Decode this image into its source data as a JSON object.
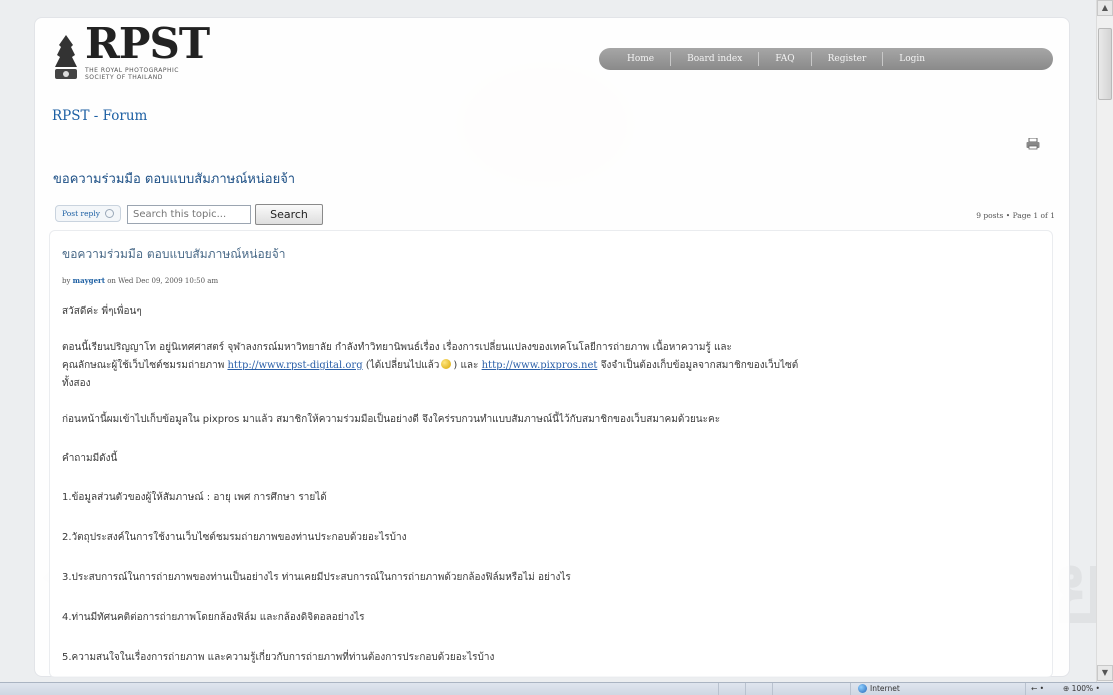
{
  "watermark": {
    "line1": "ศูนย์วิทยทรัพยากร",
    "line2": "จุฬาลงกรณ์มหาวิทยาลัย"
  },
  "logo": {
    "letters": "RPST",
    "subtitle": "THE ROYAL PHOTOGRAPHIC SOCIETY OF THAILAND"
  },
  "site_title": "RPST - Forum",
  "nav": [
    "Home",
    "Board index",
    "FAQ",
    "Register",
    "Login"
  ],
  "topic": {
    "title": "ขอความร่วมมือ ตอบแบบสัมภาษณ์หน่อยจ้า"
  },
  "actions": {
    "post_reply": "Post reply",
    "search_placeholder": "Search this topic...",
    "search_button": "Search",
    "pagination": "9 posts • Page 1 of 1"
  },
  "post": {
    "title": "ขอความร่วมมือ ตอบแบบสัมภาษณ์หน่อยจ้า",
    "meta_by": "by",
    "author": "maygert",
    "meta_date": "on Wed Dec 09, 2009 10:50 am",
    "greeting": "สวัสดีค่ะ พี่ๆเพื่อนๆ",
    "p1_a": "ตอนนี้เรียนปริญญาโท อยู่นิเทศศาสตร์ จุฬาลงกรณ์มหาวิทยาลัย กำลังทำวิทยานิพนธ์เรื่อง เรื่องการเปลี่ยนแปลงของเทคโนโลยีการถ่ายภาพ เนื้อหาความรู้ และ",
    "p1_b": "คุณลักษณะผู้ใช้เว็บไซต์ชมรมถ่ายภาพ",
    "link1": "http://www.rpst-digital.org",
    "p1_c": "(ได้เปลี่ยนไปแล้ว",
    "p1_d": ") และ",
    "link2": "http://www.pixpros.net",
    "p1_e": "จึงจำเป็นต้องเก็บข้อมูลจากสมาชิกของเว็บไซต์",
    "p1_f": "ทั้งสอง",
    "p2": "ก่อนหน้านี้ผมเข้าไปเก็บข้อมูลใน pixpros มาแล้ว สมาชิกให้ความร่วมมือเป็นอย่างดี จึงใคร่รบกวนทำแบบสัมภาษณ์นี้ไว้กับสมาชิกของเว็บสมาคมด้วยนะคะ",
    "q_head": "คำถามมีดังนี้",
    "q1": "1.ข้อมูลส่วนตัวของผู้ให้สัมภาษณ์ : อายุ เพศ การศึกษา รายได้",
    "q2": "2.วัตถุประสงค์ในการใช้งานเว็บไซต์ชมรมถ่ายภาพของท่านประกอบด้วยอะไรบ้าง",
    "q3": "3.ประสบการณ์ในการถ่ายภาพของท่านเป็นอย่างไร ท่านเคยมีประสบการณ์ในการถ่ายภาพด้วยกล้องฟิล์มหรือไม่ อย่างไร",
    "q4": "4.ท่านมีทัศนคติต่อการถ่ายภาพโดยกล้องฟิล์ม และกล้องดิจิตอลอย่างไร",
    "q5": "5.ความสนใจในเรื่องการถ่ายภาพ และความรู้เกี่ยวกับการถ่ายภาพที่ท่านต้องการประกอบด้วยอะไรบ้าง"
  },
  "statusbar": {
    "zone": "Internet",
    "protected": "← •",
    "zoom": "⊕ 100%  •"
  },
  "scrollbar": {
    "up": "▲",
    "down": "▼"
  }
}
